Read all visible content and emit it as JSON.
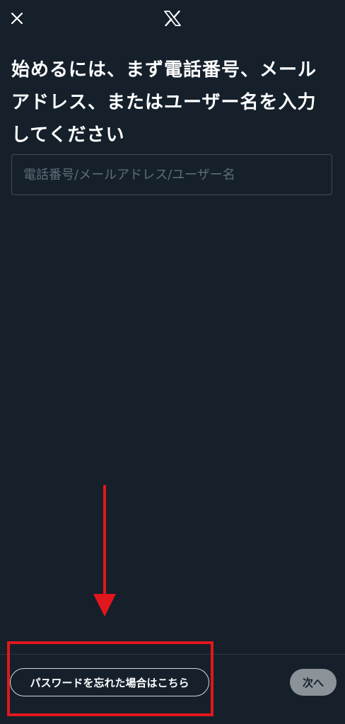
{
  "header": {
    "close_icon": "close-icon",
    "logo_icon": "x-logo-icon"
  },
  "main": {
    "heading": "始めるには、まず電話番号、メールアドレス、またはユーザー名を入力してください",
    "input": {
      "placeholder": "電話番号/メールアドレス/ユーザー名",
      "value": ""
    }
  },
  "footer": {
    "forgot_password_label": "パスワードを忘れた場合はこちら",
    "next_label": "次へ"
  },
  "annotation": {
    "arrow_icon": "arrow-down-icon",
    "color": "#e0171d"
  },
  "colors": {
    "background": "#15202b",
    "next_button_bg": "#8b9399"
  }
}
